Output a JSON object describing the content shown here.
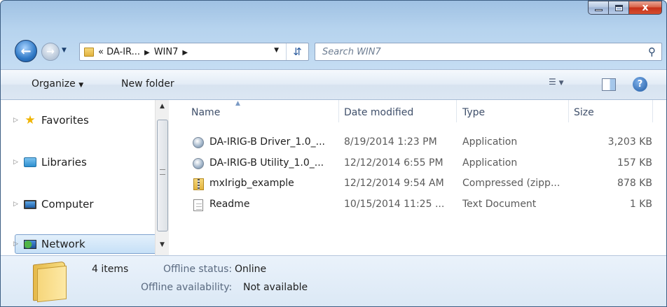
{
  "window": {
    "title": "",
    "controls": {
      "minimize": "minimize",
      "maximize": "maximize",
      "close": "x"
    }
  },
  "nav": {
    "breadcrumb": [
      "«",
      "DA-IR...",
      "WIN7"
    ],
    "search_placeholder": "Search WIN7"
  },
  "toolbar": {
    "organize": "Organize",
    "new_folder": "New folder",
    "help": "?"
  },
  "sidebar": {
    "items": [
      {
        "label": "Favorites",
        "icon": "star-icon"
      },
      {
        "label": "Libraries",
        "icon": "libraries-icon"
      },
      {
        "label": "Computer",
        "icon": "computer-icon"
      },
      {
        "label": "Network",
        "icon": "network-icon",
        "selected": true
      }
    ]
  },
  "list": {
    "columns": [
      "Name",
      "Date modified",
      "Type",
      "Size"
    ],
    "rows": [
      {
        "name": "DA-IRIG-B Driver_1.0_...",
        "date": "8/19/2014 1:23 PM",
        "type": "Application",
        "size": "3,203 KB",
        "icon": "application-icon"
      },
      {
        "name": "DA-IRIG-B Utility_1.0_...",
        "date": "12/12/2014 6:55 PM",
        "type": "Application",
        "size": "157 KB",
        "icon": "application-icon"
      },
      {
        "name": "mxIrigb_example",
        "date": "12/12/2014 9:54 AM",
        "type": "Compressed (zipp...",
        "size": "878 KB",
        "icon": "zip-folder-icon"
      },
      {
        "name": "Readme",
        "date": "10/15/2014 11:25 ...",
        "type": "Text Document",
        "size": "1 KB",
        "icon": "text-document-icon"
      }
    ]
  },
  "details": {
    "count": "4 items",
    "offline_status_label": "Offline status:",
    "offline_status_value": "Online",
    "offline_avail_label": "Offline availability:",
    "offline_avail_value": "Not available"
  }
}
